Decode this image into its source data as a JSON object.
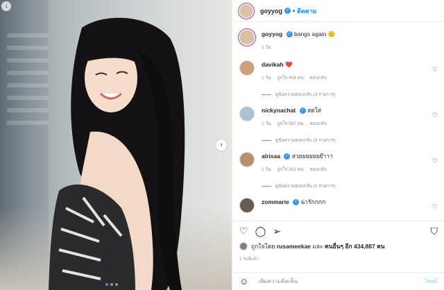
{
  "header": {
    "username": "goyyog",
    "separator": "•",
    "follow_label": "ติดตาม"
  },
  "caption": {
    "username": "goyyog",
    "text": "bangs again",
    "emoji": "🫡",
    "time": "1 วัน"
  },
  "comments": [
    {
      "username": "davikah",
      "text": "❤️",
      "time": "1 วัน",
      "likes": "ถูกใจ 408 คน",
      "reply": "ตอบกลับ",
      "view_replies": "ดูข้อความตอบกลับ (3 รายการ)",
      "avatar_color": "#caa07e"
    },
    {
      "username": "nickynachat",
      "text": "สดใส",
      "time": "1 วัน",
      "likes": "ถูกใจ 567 คน",
      "reply": "ตอบกลับ",
      "view_replies": "ดูข้อความตอบกลับ (9 รายการ)",
      "avatar_color": "#a7c3d4"
    },
    {
      "username": "alrisaa",
      "text": "สวยยยยยยย๊าาา",
      "time": "1 วัน",
      "likes": "ถูกใจ 252 คน",
      "reply": "ตอบกลับ",
      "view_replies": "ดูข้อความตอบกลับ (1 รายการ)",
      "avatar_color": "#b3916b"
    },
    {
      "username": "zommarie",
      "text": "น่ารักกกก",
      "avatar_color": "#6b5a4f"
    }
  ],
  "likes_line": {
    "prefix": "ถูกใจโดย",
    "user": "rusameekae",
    "middle": "และ",
    "others": "คนอื่นๆ อีก 434,887 คน"
  },
  "time_ago": "1 วันที่แล้ว",
  "add_comment": {
    "placeholder": "เพิ่มความคิดเห็น",
    "post_label": "โพสต์"
  },
  "icons": {
    "back": "arrow-down-icon",
    "next": "chevron-right-icon",
    "like": "heart-icon",
    "comment": "comment-icon",
    "share": "send-icon",
    "save": "bookmark-icon",
    "emoji": "smiley-icon"
  },
  "colors": {
    "link_blue": "#0095f6",
    "verified_blue": "#3897f0",
    "heart_red": "#ed4956",
    "muted": "#8e8e8e"
  },
  "carousel": {
    "total": 3,
    "active_index": 0
  }
}
